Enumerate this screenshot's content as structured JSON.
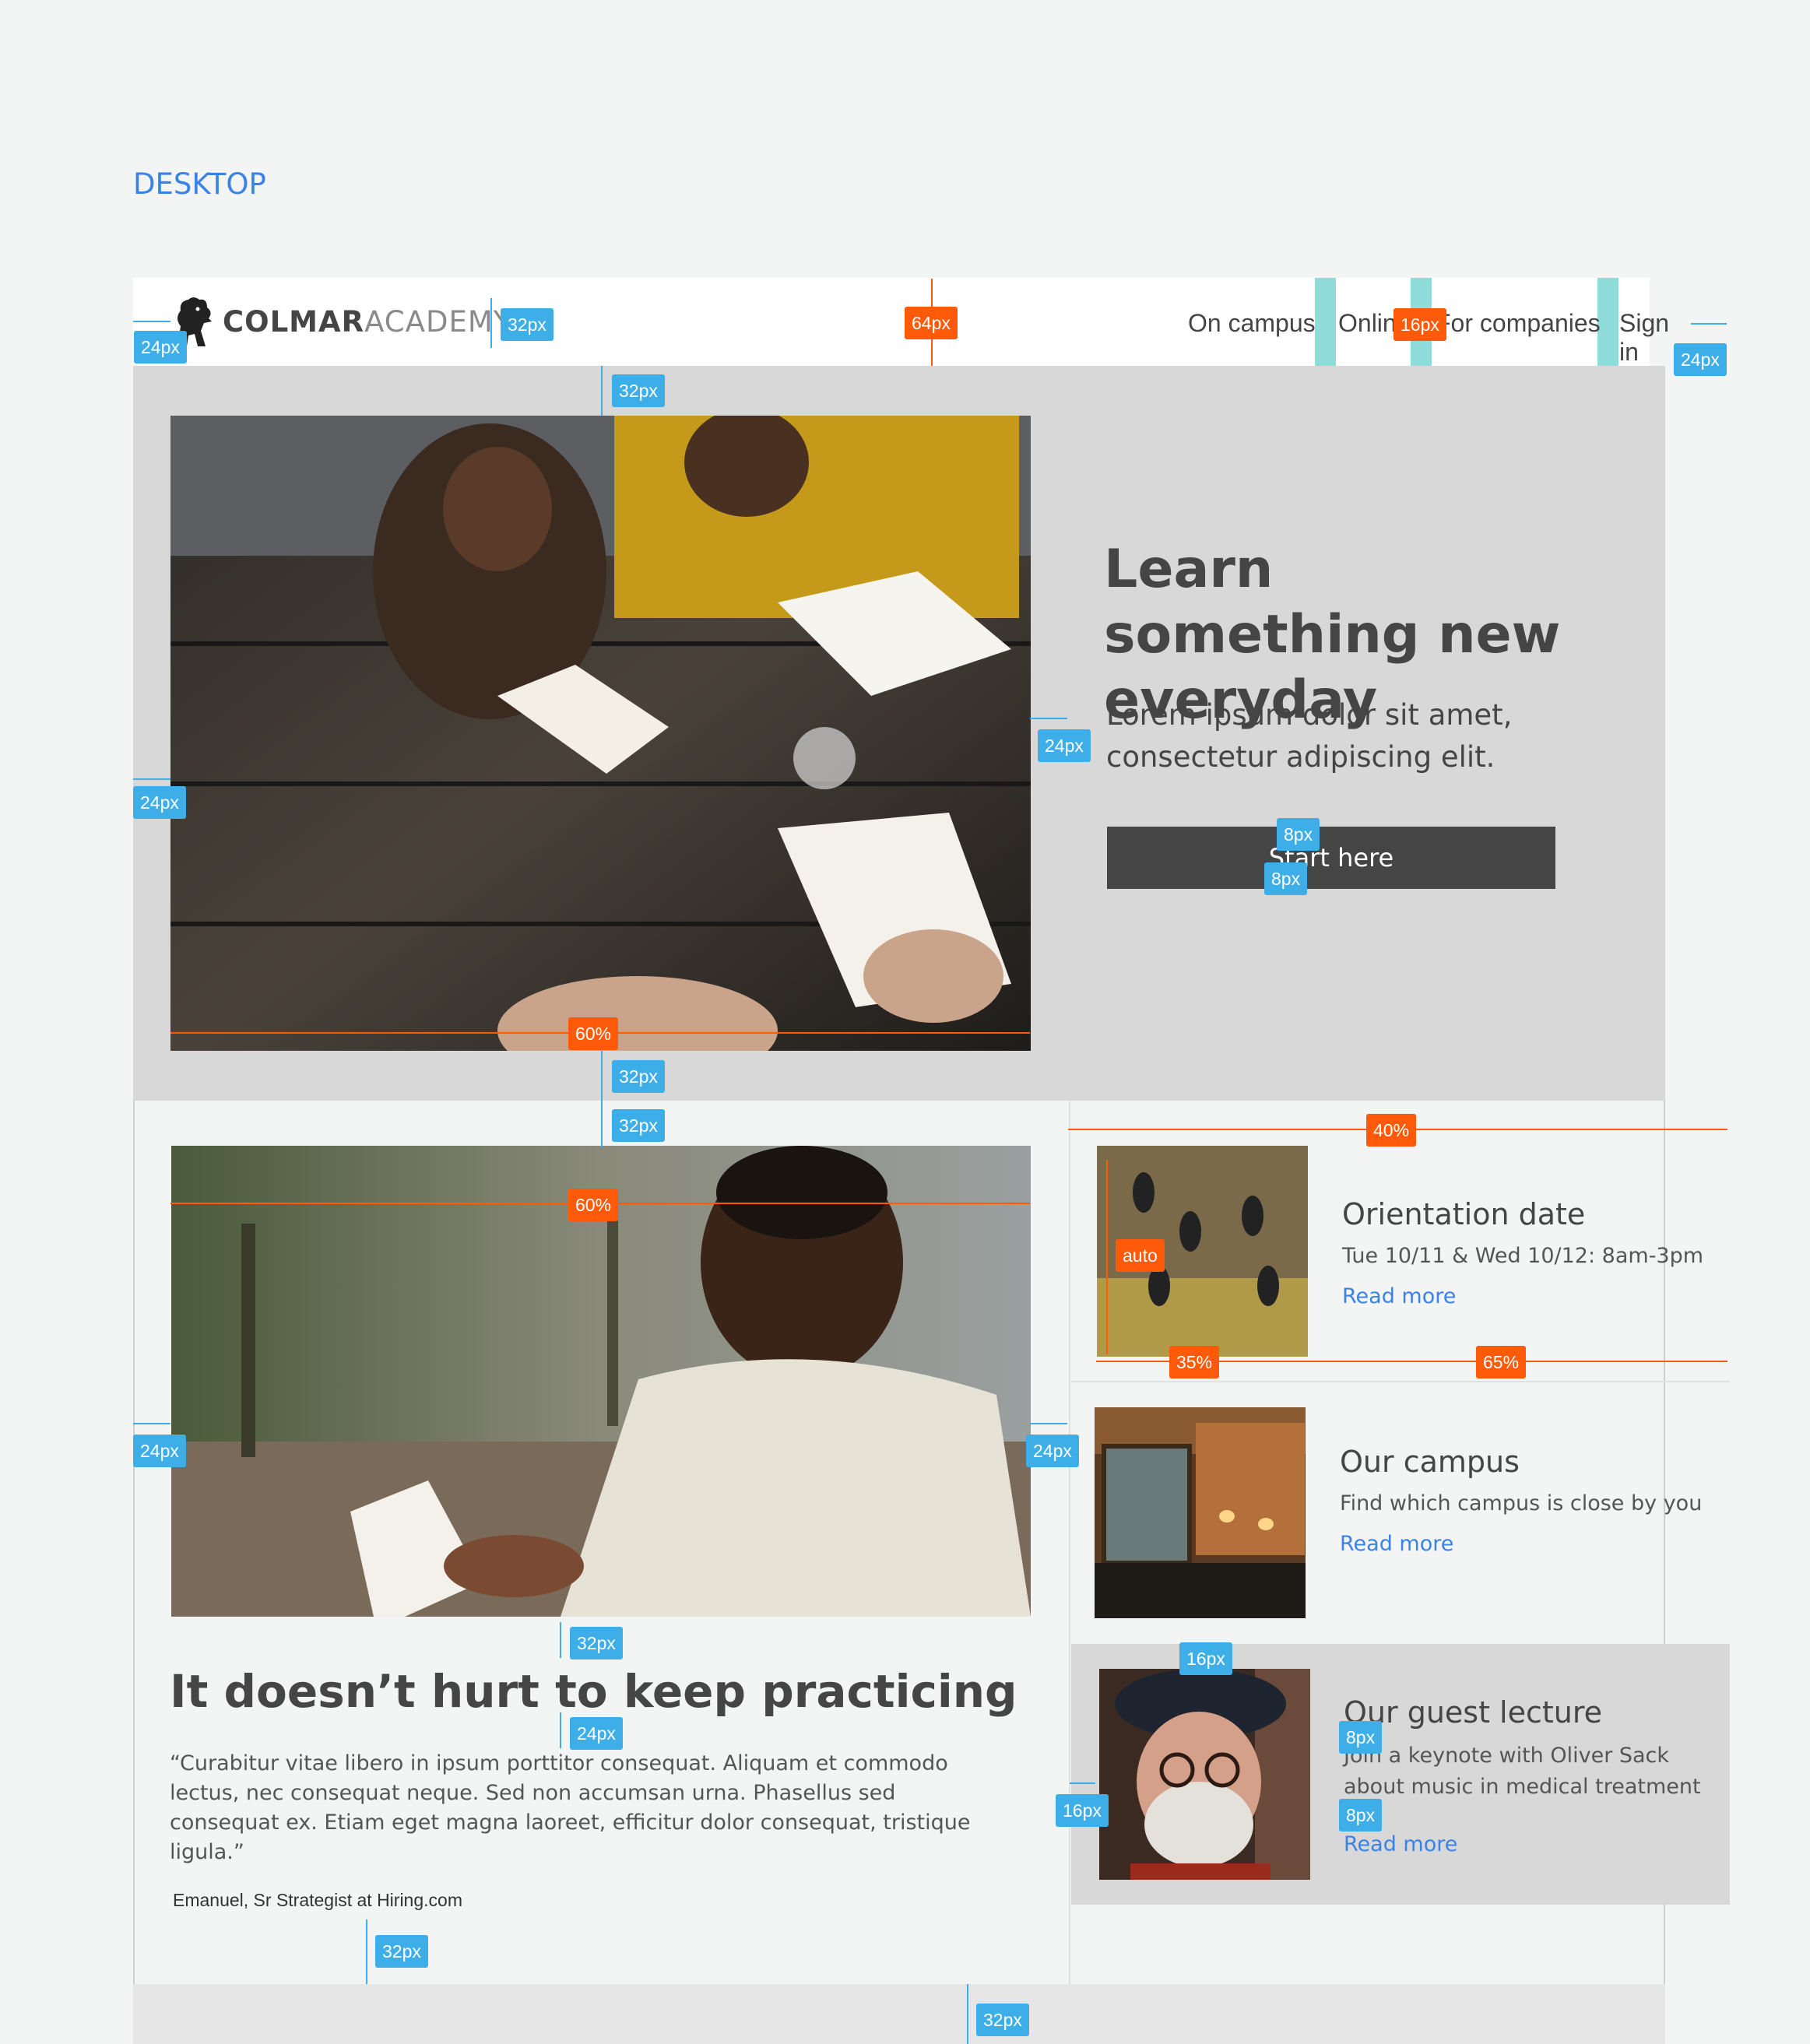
{
  "view_label": "DESKTOP",
  "header": {
    "logo_bold": "COLMAR",
    "logo_light": "ACADEMY",
    "nav": [
      "On campus",
      "Online",
      "For companies",
      "Sign in"
    ]
  },
  "hero": {
    "title": "Learn something new everyday",
    "subtitle": "Lorem ipsum dolor sit amet, consectetur adipiscing elit.",
    "button": "Start here"
  },
  "practice": {
    "title": "It doesn’t hurt to keep practicing",
    "quote": "“Curabitur vitae libero in ipsum porttitor consequat. Aliquam et commodo lectus, nec consequat neque. Sed non accumsan urna. Phasellus sed consequat ex. Etiam eget magna laoreet, efficitur dolor consequat, tristique ligula.”",
    "author": "Emanuel, Sr Strategist at Hiring.com"
  },
  "cards": [
    {
      "title": "Orientation date",
      "desc": "Tue 10/11 & Wed 10/12: 8am-3pm",
      "link": "Read more"
    },
    {
      "title": "Our campus",
      "desc": "Find which campus is close by you",
      "link": "Read more"
    },
    {
      "title": "Our guest lecture",
      "desc": "Join a keynote with Oliver Sack about music in medical treatment",
      "link": "Read more"
    }
  ],
  "spec_tags": {
    "px8": "8px",
    "px16": "16px",
    "px24": "24px",
    "px32": "32px",
    "px64": "64px",
    "pct35": "35%",
    "pct40": "40%",
    "pct60": "60%",
    "pct65": "65%",
    "auto": "auto"
  },
  "colors": {
    "accent_blue": "#3b82e6",
    "spec_blue": "#3eaee8",
    "spec_orange": "#ff5a0a",
    "text_dark": "#454545",
    "hero_bg": "#d8d8d8",
    "guide_teal": "#8fdcdb"
  }
}
